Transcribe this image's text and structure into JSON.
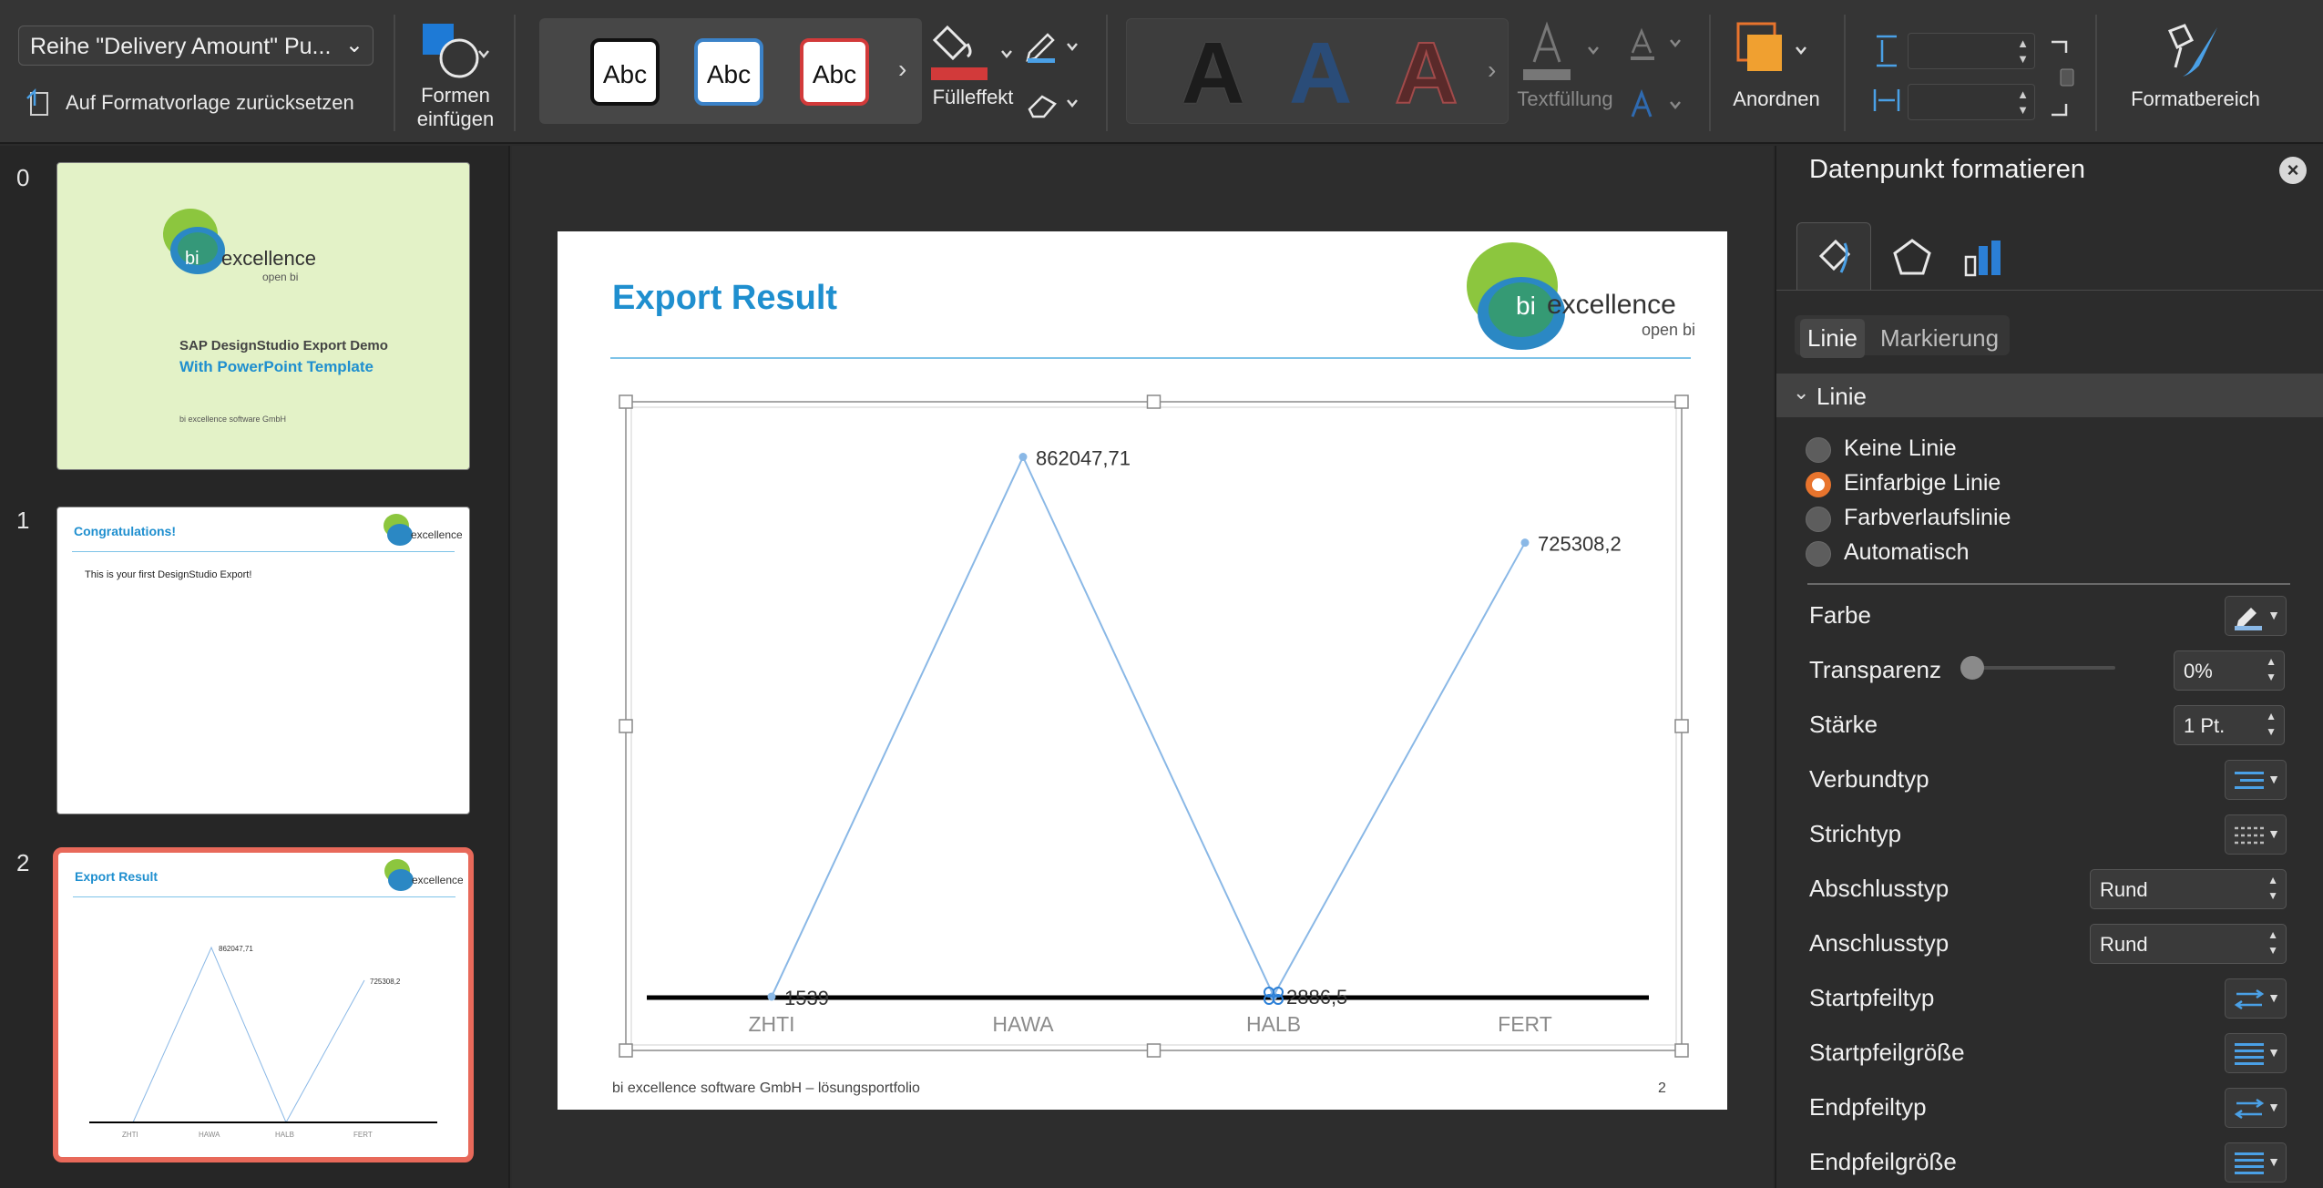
{
  "ribbon": {
    "series_select": "Reihe \"Delivery Amount\" Pu...",
    "reset_label": "Auf Formatvorlage zurücksetzen",
    "insert_shapes_line1": "Formen",
    "insert_shapes_line2": "einfügen",
    "style_swatches": [
      "Abc",
      "Abc",
      "Abc"
    ],
    "fill_effect_label": "Fülleffekt",
    "wordart_letters": [
      "A",
      "A",
      "A"
    ],
    "text_fill_label": "Textfüllung",
    "arrange_label": "Anordnen",
    "format_pane_label": "Formatbereich"
  },
  "thumbnails": {
    "numbers": [
      "0",
      "1",
      "2"
    ],
    "slide0": {
      "brand": "excellence",
      "brand_prefix": "bi",
      "brand_sub": "open bi",
      "title": "SAP DesignStudio Export Demo",
      "subtitle": "With PowerPoint Template",
      "company": "bi excellence software GmbH"
    },
    "slide1": {
      "title": "Congratulations!",
      "body": "This is your first DesignStudio Export!"
    },
    "slide2": {
      "title": "Export Result"
    }
  },
  "slide": {
    "title": "Export Result",
    "logo_prefix": "bi",
    "logo_text": "excellence",
    "logo_sub": "open bi",
    "footer": "bi excellence software GmbH – lösungsportfolio",
    "page_number": "2"
  },
  "chart_data": {
    "type": "line",
    "categories": [
      "ZHTI",
      "HAWA",
      "HALB",
      "FERT"
    ],
    "series": [
      {
        "values": [
          1539,
          862047.71,
          2886.5,
          725308.2
        ]
      }
    ],
    "data_labels": [
      "1539",
      "862047,71",
      "2886,5",
      "725308,2"
    ],
    "ylim": [
      0,
      950000
    ],
    "line_color": "#8ab8e6",
    "baseline_color": "#000000"
  },
  "pane": {
    "title": "Datenpunkt formatieren",
    "tabs": [
      "Linie",
      "Markierung"
    ],
    "section": "Linie",
    "line_options": [
      "Keine Linie",
      "Einfarbige Linie",
      "Farbverlaufslinie",
      "Automatisch"
    ],
    "selected_option": "Einfarbige Linie",
    "labels": {
      "farbe": "Farbe",
      "transparenz": "Transparenz",
      "staerke": "Stärke",
      "verbundtyp": "Verbundtyp",
      "strichtyp": "Strichtyp",
      "abschlusstyp": "Abschlusstyp",
      "anschlusstyp": "Anschlusstyp",
      "startpfeiltyp": "Startpfeiltyp",
      "startpfeilgroesse": "Startpfeilgröße",
      "endpfeiltyp": "Endpfeiltyp",
      "endpfeilgroesse": "Endpfeilgröße"
    },
    "values": {
      "transparenz": "0%",
      "staerke": "1 Pt.",
      "abschlusstyp": "Rund",
      "anschlusstyp": "Rund"
    }
  },
  "colors": {
    "accent": "#e8742d",
    "slide_title": "#1f8fcf",
    "thumb0_bg": "#e3f2c7",
    "selected_thumb_border": "#e8695a"
  }
}
